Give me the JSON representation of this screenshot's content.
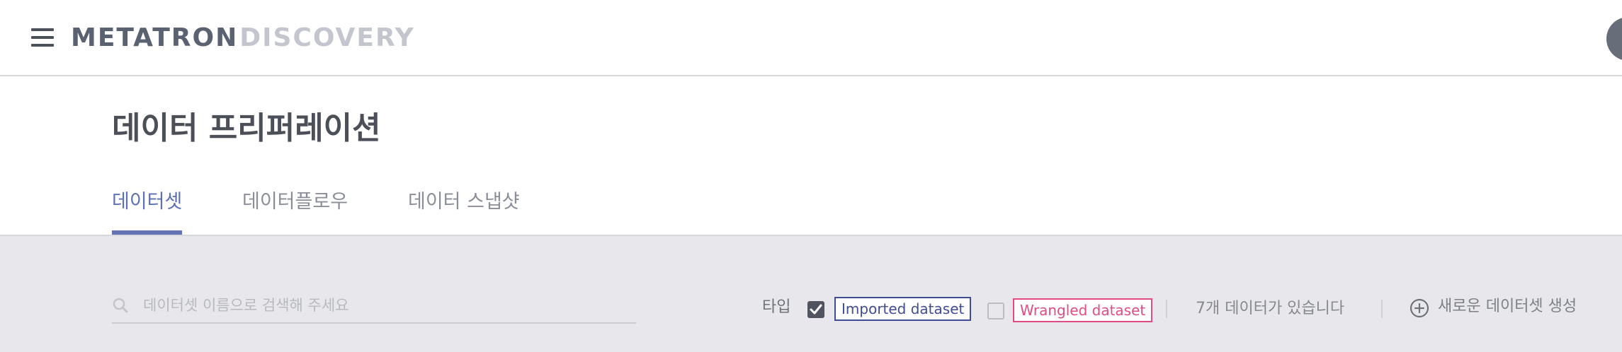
{
  "app": {
    "logo_primary": "METATRON",
    "logo_secondary": "DISCOVERY"
  },
  "header": {
    "title": "데이터 프리퍼레이션",
    "tabs": [
      {
        "label": "데이터셋",
        "active": true
      },
      {
        "label": "데이터플로우",
        "active": false
      },
      {
        "label": "데이터 스냅샷",
        "active": false
      }
    ]
  },
  "filters": {
    "search_placeholder": "데이터셋 이름으로 검색해 주세요",
    "search_value": "",
    "type_label": "타입",
    "types": [
      {
        "label": "Imported dataset",
        "checked": true,
        "color": "#3f4d95"
      },
      {
        "label": "Wrangled dataset",
        "checked": false,
        "color": "#e14c84"
      }
    ],
    "count_text": "7개 데이터가 있습니다",
    "new_button_label": "새로운 데이터셋 생성"
  },
  "colors": {
    "accent": "#6472b6",
    "filter_background": "#e8e8ec"
  }
}
